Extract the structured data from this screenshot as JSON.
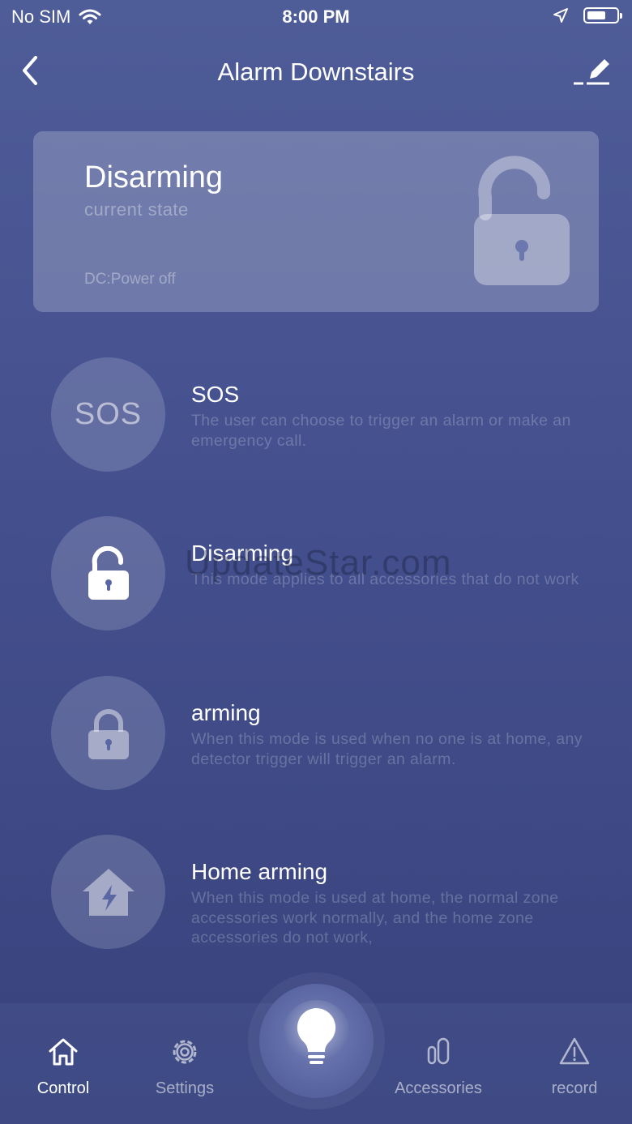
{
  "status_bar": {
    "carrier": "No SIM",
    "time": "8:00 PM"
  },
  "nav": {
    "title": "Alarm Downstairs"
  },
  "state_card": {
    "title": "Disarming",
    "subtitle": "current state",
    "dc_status": "DC:Power off"
  },
  "modes": [
    {
      "title": "SOS",
      "icon_text": "SOS",
      "description": "The user can choose to trigger an alarm or make an emergency call.",
      "icon": "sos-icon"
    },
    {
      "title": "Disarming",
      "description": "This mode applies to all accessories that do not work",
      "icon": "unlocked-padlock-icon"
    },
    {
      "title": "arming",
      "description": "When this mode is used when no one is at home, any detector trigger will trigger an alarm.",
      "icon": "locked-padlock-icon"
    },
    {
      "title": "Home arming",
      "description": "When this mode is used at home, the normal zone accessories work normally, and the home zone accessories do not work,",
      "icon": "home-lightning-icon"
    }
  ],
  "watermark": "UpdateStar.com",
  "tabs": [
    {
      "label": "Control",
      "icon": "home-icon",
      "active": true
    },
    {
      "label": "Settings",
      "icon": "gear-icon",
      "active": false
    },
    {
      "label": "",
      "icon": "lightbulb-icon",
      "active": false
    },
    {
      "label": "Accessories",
      "icon": "accessories-icon",
      "active": false
    },
    {
      "label": "record",
      "icon": "warning-icon",
      "active": false
    }
  ]
}
